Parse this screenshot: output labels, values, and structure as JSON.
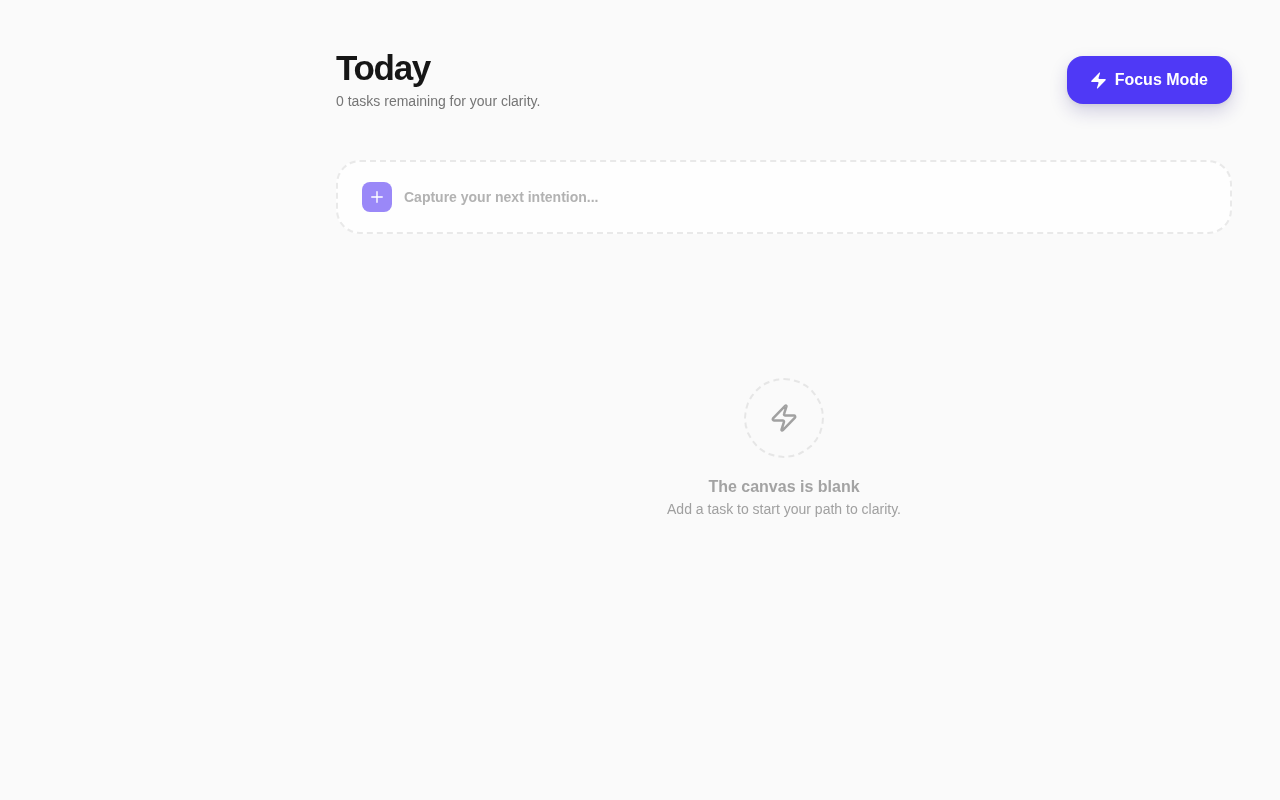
{
  "header": {
    "title": "Today",
    "subtitle": "0 tasks remaining for your clarity."
  },
  "focus_button": {
    "label": "Focus Mode"
  },
  "task_input": {
    "placeholder": "Capture your next intention..."
  },
  "empty_state": {
    "title": "The canvas is blank",
    "message": "Add a task to start your path to clarity."
  }
}
